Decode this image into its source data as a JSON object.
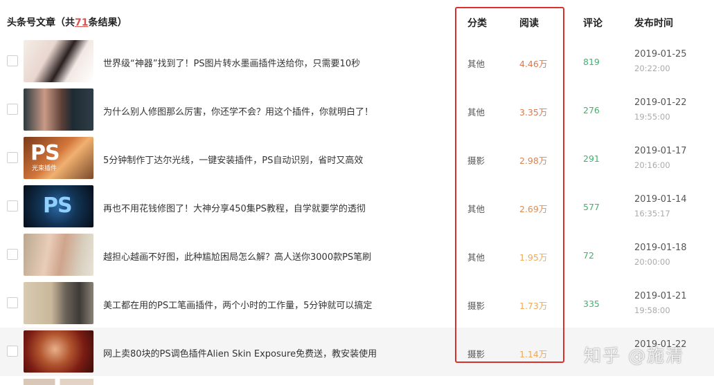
{
  "header": {
    "title_prefix": "头条号文章（共",
    "count": "71",
    "title_suffix": "条结果）",
    "col_category": "分类",
    "col_reads": "阅读",
    "col_comments": "评论",
    "col_publish_time": "发布时间"
  },
  "colors": {
    "highlight_box": "#d9302b",
    "comment_green": "#3bb56b",
    "read_orange_dark": "#e0764c",
    "read_orange_light": "#f0a855"
  },
  "rows": [
    {
      "title": "世界级“神器”找到了！PS图片转水墨画插件送给你，只需要10秒",
      "category": "其他",
      "reads": "4.46万",
      "comments": "819",
      "date": "2019-01-25",
      "time": "20:22:00",
      "read_color": "#e0764c"
    },
    {
      "title": "为什么别人修图那么厉害，你还学不会？用这个插件，你就明白了！",
      "category": "其他",
      "reads": "3.35万",
      "comments": "276",
      "date": "2019-01-22",
      "time": "19:55:00",
      "read_color": "#e0764c"
    },
    {
      "title": "5分钟制作丁达尔光线，一键安装插件，PS自动识别，省时又高效",
      "category": "摄影",
      "reads": "2.98万",
      "comments": "291",
      "date": "2019-01-17",
      "time": "20:16:00",
      "read_color": "#e0824f"
    },
    {
      "title": "再也不用花钱修图了！大神分享450集PS教程，自学就要学的透彻",
      "category": "其他",
      "reads": "2.69万",
      "comments": "577",
      "date": "2019-01-14",
      "time": "16:35:17",
      "read_color": "#e58b4f"
    },
    {
      "title": "越担心越画不好图，此种尴尬困局怎么解？高人送你3000款PS笔刷",
      "category": "其他",
      "reads": "1.95万",
      "comments": "72",
      "date": "2019-01-18",
      "time": "20:00:00",
      "read_color": "#f0a855"
    },
    {
      "title": "美工都在用的PS工笔画插件，两个小时的工作量，5分钟就可以搞定",
      "category": "摄影",
      "reads": "1.73万",
      "comments": "335",
      "date": "2019-01-21",
      "time": "19:58:00",
      "read_color": "#f0a855"
    },
    {
      "title": "网上卖80块的PS调色插件Alien Skin Exposure免费送，教安装使用",
      "category": "摄影",
      "reads": "1.14万",
      "comments": "",
      "date": "2019-01-22",
      "time": "",
      "read_color": "#f0a855"
    }
  ],
  "thumbnails": [
    {
      "icon": "portrait-thumbnail"
    },
    {
      "icon": "portrait-editing-thumbnail"
    },
    {
      "icon": "ps-logo-thumbnail",
      "text": "PS",
      "tag": "光束插件"
    },
    {
      "icon": "ps-splash-thumbnail",
      "text": "PS"
    },
    {
      "icon": "fantasy-portrait-thumbnail"
    },
    {
      "icon": "gongbi-painting-thumbnail"
    },
    {
      "icon": "bride-portrait-thumbnail"
    }
  ],
  "watermark": "知乎 @施清"
}
